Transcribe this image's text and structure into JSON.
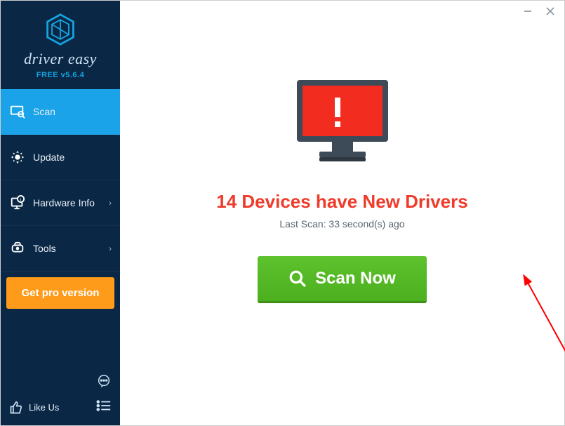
{
  "brand": {
    "name": "driver easy",
    "version": "FREE v5.6.4"
  },
  "sidebar": {
    "items": [
      {
        "label": "Scan",
        "icon": "scan-icon",
        "active": true,
        "hasSub": false
      },
      {
        "label": "Update",
        "icon": "update-icon",
        "active": false,
        "hasSub": false
      },
      {
        "label": "Hardware Info",
        "icon": "hardware-icon",
        "active": false,
        "hasSub": true
      },
      {
        "label": "Tools",
        "icon": "tools-icon",
        "active": false,
        "hasSub": true
      }
    ],
    "promo": "Get pro version",
    "likeus": "Like Us"
  },
  "main": {
    "headline": "14 Devices have New Drivers",
    "subline": "Last Scan: 33 second(s) ago",
    "scan_button": "Scan Now"
  },
  "colors": {
    "sidebar_bg": "#0a2846",
    "active": "#1aa3e8",
    "promo": "#ff9b1a",
    "headline": "#f03a2a",
    "scan_btn": "#5ec22e"
  }
}
